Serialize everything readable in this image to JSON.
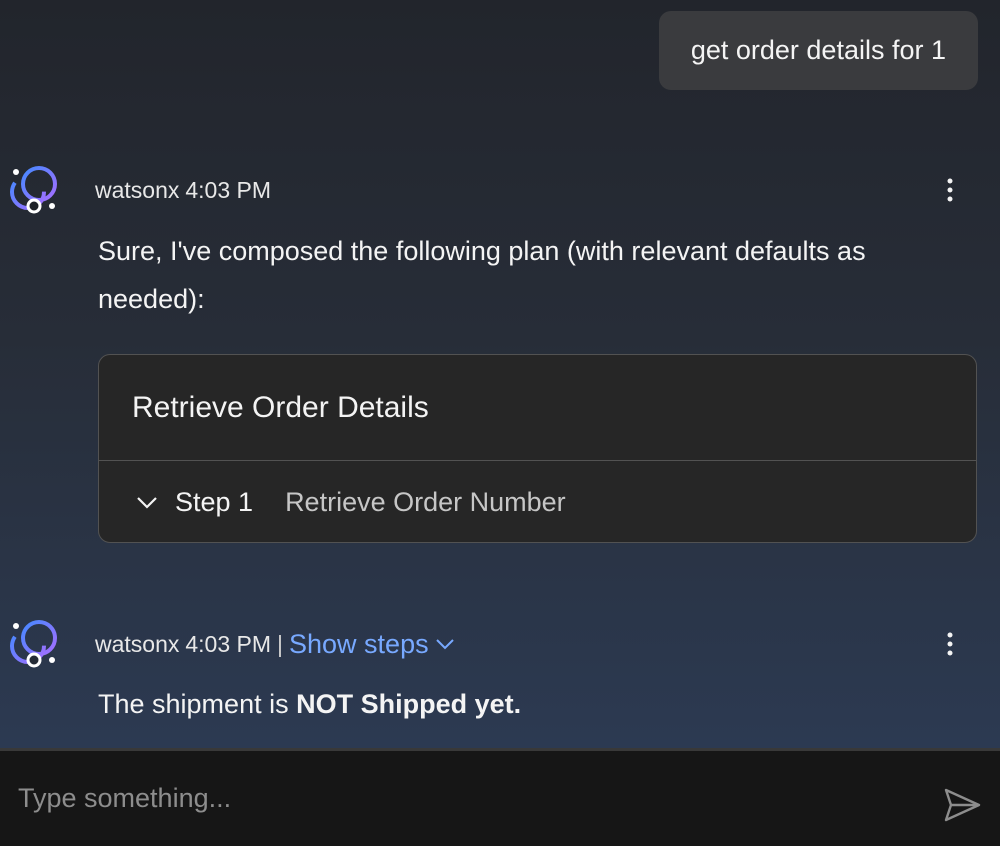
{
  "user_message": {
    "text": "get order details for 1"
  },
  "messages": [
    {
      "sender": "watsonx",
      "time": "4:03 PM",
      "text": "Sure, I've composed the following plan (with relevant defaults as needed):",
      "plan": {
        "title": "Retrieve Order Details",
        "steps": [
          {
            "label": "Step 1",
            "description": "Retrieve Order Number"
          }
        ]
      }
    },
    {
      "sender": "watsonx",
      "time": "4:03 PM",
      "separator": "|",
      "show_steps_label": "Show steps",
      "text_prefix": "The shipment is ",
      "text_bold": "NOT Shipped yet."
    }
  ],
  "input": {
    "placeholder": "Type something..."
  },
  "colors": {
    "accent": "#78a9ff",
    "avatar_primary": "#8a9cff",
    "input_bg": "#161616",
    "card_bg": "#262626"
  },
  "icons": {
    "avatar": "watsonx-avatar-icon",
    "menu": "overflow-menu-vertical-icon",
    "chevron": "chevron-down-icon",
    "send": "send-icon"
  }
}
